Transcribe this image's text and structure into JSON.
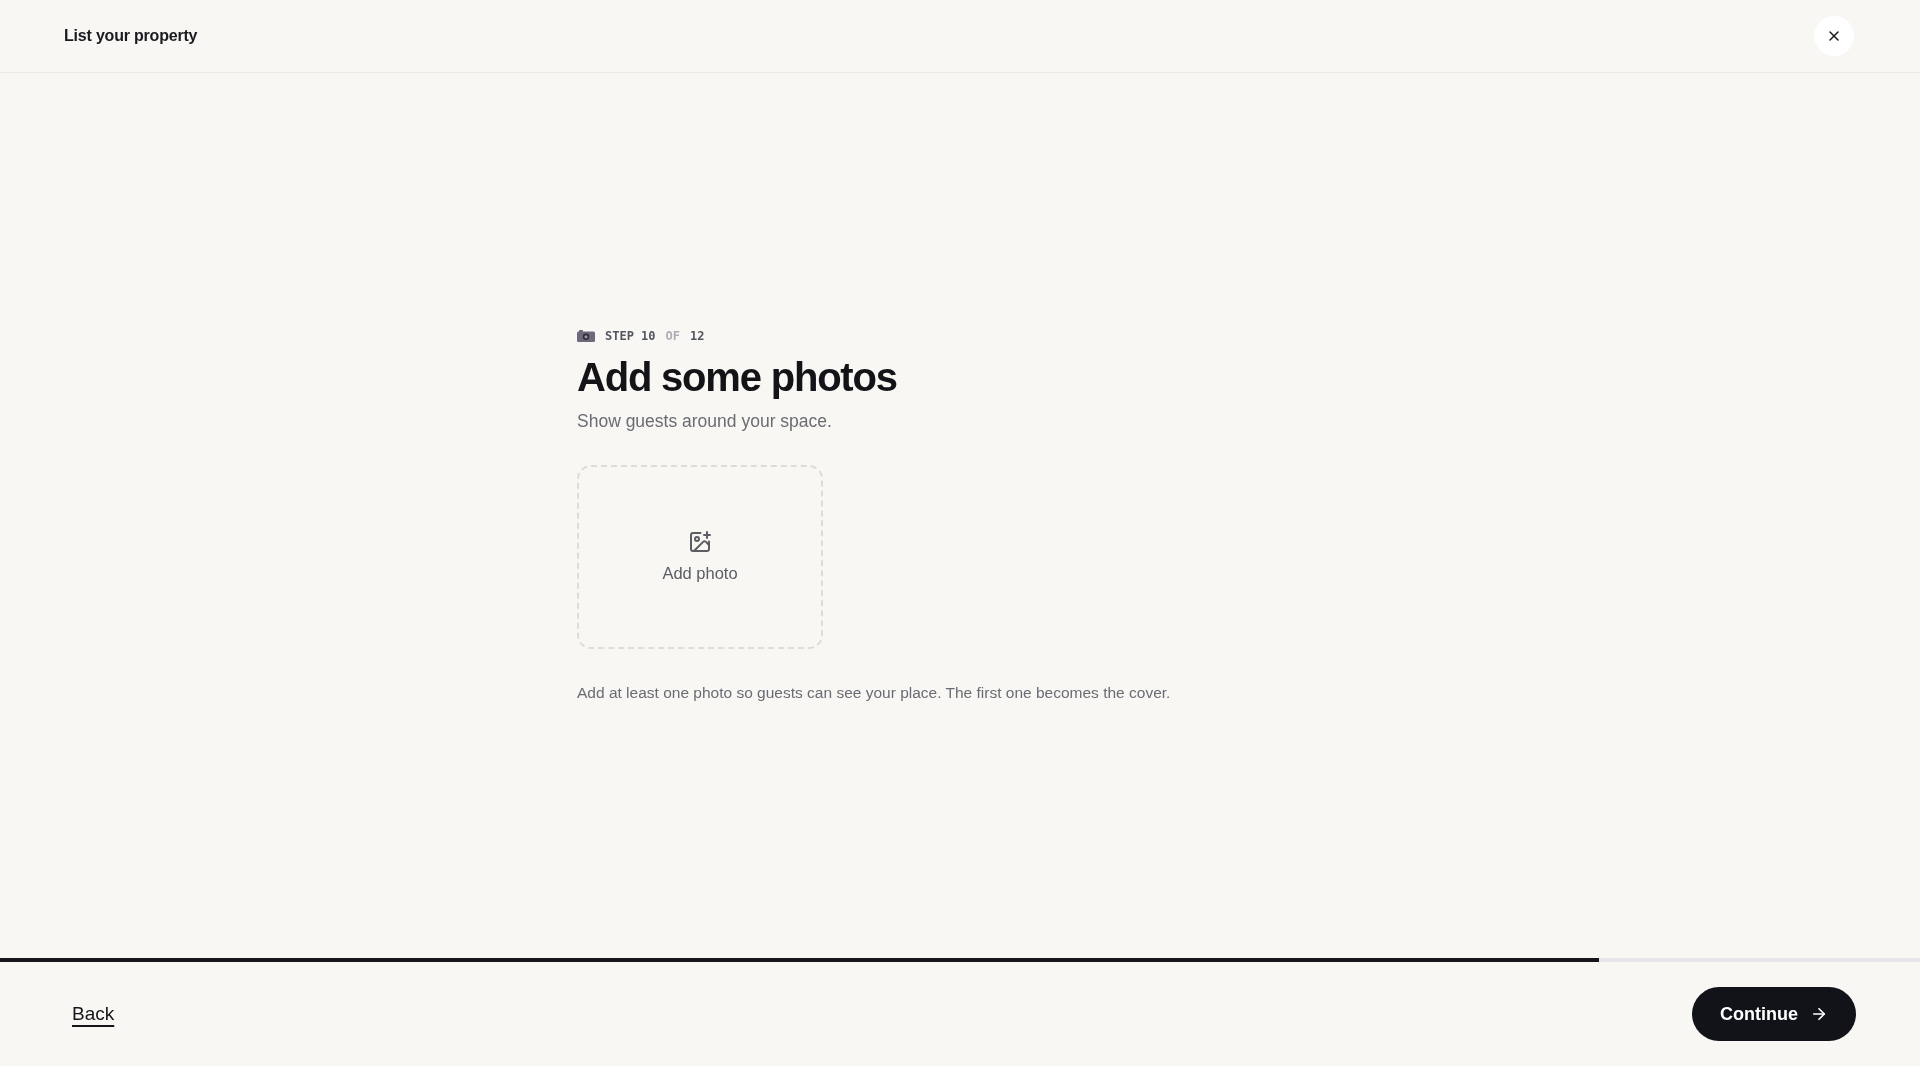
{
  "header": {
    "title": "List your property"
  },
  "step": {
    "text": "STEP 10",
    "separator": "OF",
    "total": "12"
  },
  "heading": "Add some photos",
  "subtitle": "Show guests around your space.",
  "upload": {
    "label": "Add photo"
  },
  "helper_text": "Add at least one photo so guests can see your place. The first one becomes the cover.",
  "progress": {
    "level": 0.833
  },
  "footer": {
    "back": "Back",
    "continue": "Continue"
  }
}
